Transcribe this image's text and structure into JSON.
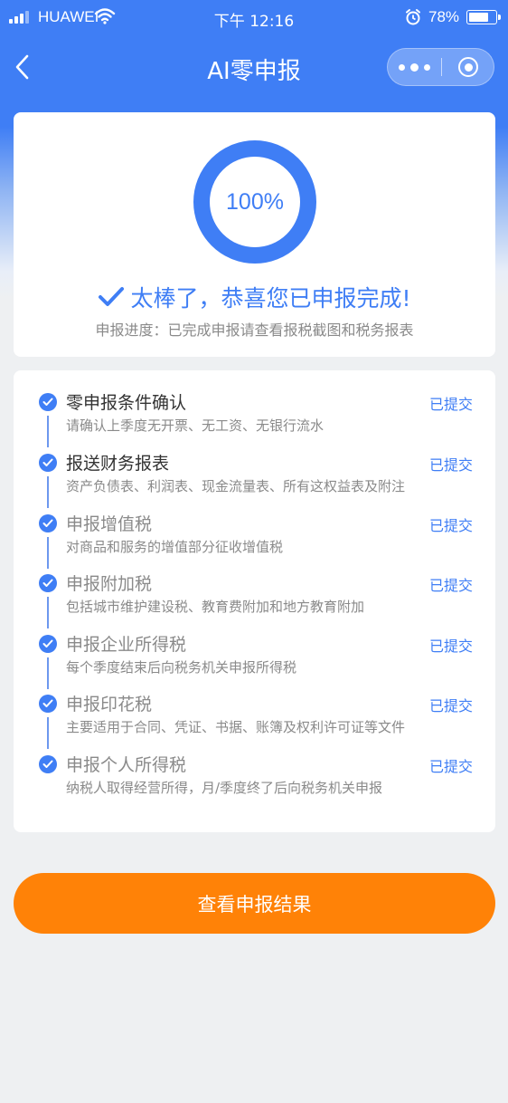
{
  "status_bar": {
    "carrier": "HUAWEI",
    "time": "下午 12:16",
    "battery": "78%",
    "battery_level": 0.78
  },
  "nav": {
    "title": "AI零申报"
  },
  "summary": {
    "progress_text": "100%",
    "progress_value": 1.0,
    "success_message": "太棒了，恭喜您已申报完成!",
    "progress_note": "申报进度：已完成申报请查看报税截图和税务报表"
  },
  "steps": [
    {
      "title": "零申报条件确认",
      "desc": "请确认上季度无开票、无工资、无银行流水",
      "status": "已提交"
    },
    {
      "title": "报送财务报表",
      "desc": "资产负债表、利润表、现金流量表、所有这权益表及附注",
      "status": "已提交"
    },
    {
      "title": "申报增值税",
      "desc": "对商品和服务的增值部分征收增值税",
      "status": "已提交"
    },
    {
      "title": "申报附加税",
      "desc": "包括城市维护建设税、教育费附加和地方教育附加",
      "status": "已提交"
    },
    {
      "title": "申报企业所得税",
      "desc": "每个季度结束后向税务机关申报所得税",
      "status": "已提交"
    },
    {
      "title": "申报印花税",
      "desc": "主要适用于合同、凭证、书据、账簿及权利许可证等文件",
      "status": "已提交"
    },
    {
      "title": "申报个人所得税",
      "desc": "纳税人取得经营所得，月/季度终了后向税务机关申报",
      "status": "已提交"
    }
  ],
  "action": {
    "button_label": "查看申报结果"
  },
  "colors": {
    "primary": "#3f7ef5",
    "accent": "#ff8207",
    "background": "#eef0f2"
  }
}
